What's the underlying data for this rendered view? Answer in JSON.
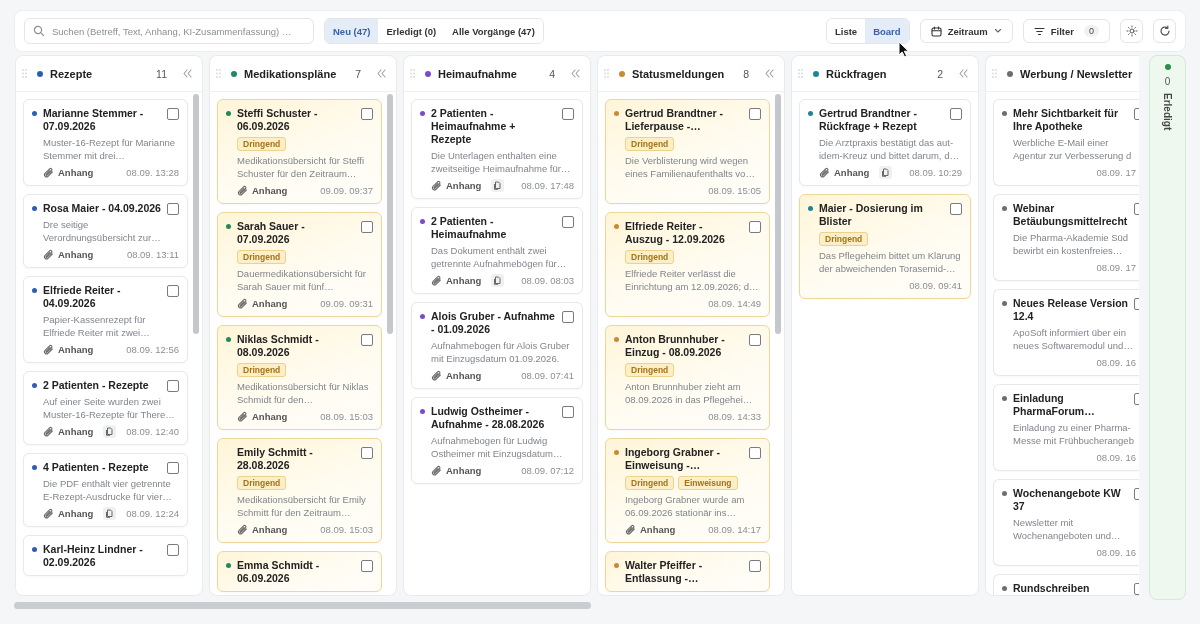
{
  "toolbar": {
    "search": {
      "placeholder": "Suchen (Betreff, Text, Anhang, KI-Zusammenfassung) …"
    },
    "status_tabs": [
      {
        "label": "Neu (47)",
        "selected": true
      },
      {
        "label": "Erledigt (0)",
        "selected": false
      },
      {
        "label": "Alle Vorgänge (47)",
        "selected": false
      }
    ],
    "view_tabs": [
      {
        "label": "Liste",
        "selected": false
      },
      {
        "label": "Board",
        "selected": true
      }
    ],
    "date_button": {
      "label": "Zeitraum"
    },
    "filter_button": {
      "label": "Filter",
      "count": "0"
    }
  },
  "columns": [
    {
      "name": "Rezepte",
      "color": "#2f5db5",
      "count": "11",
      "scrollable": true,
      "cards": [
        {
          "title": "Marianne Stemmer - 07.09.2026",
          "unread": true,
          "urgent": false,
          "checked": false,
          "description": "Muster-16-Rezept für Marianne Stemmer mit drei…",
          "attachment": "Anhang",
          "multi_page": false,
          "time": "08.09. 13:28"
        },
        {
          "title": "Rosa Maier - 04.09.2026",
          "unread": true,
          "urgent": false,
          "checked": false,
          "description": "Dre seitige Verordnungsübersicht zur…",
          "attachment": "Anhang",
          "multi_page": false,
          "time": "08.09. 13:11"
        },
        {
          "title": "Elfriede Reiter - 04.09.2026",
          "unread": true,
          "urgent": false,
          "checked": false,
          "description": "Papier-Kassenrezept für Elfriede Reiter mit zwei…",
          "attachment": "Anhang",
          "multi_page": false,
          "time": "08.09. 12:56"
        },
        {
          "title": "2 Patienten - Rezepte",
          "unread": true,
          "urgent": false,
          "checked": false,
          "description": "Auf einer Seite wurden zwei Muster-16-Rezepte für There…",
          "attachment": "Anhang",
          "multi_page": true,
          "time": "08.09. 12:40"
        },
        {
          "title": "4 Patienten - Rezepte",
          "unread": true,
          "urgent": false,
          "checked": false,
          "description": "Die PDF enthält vier getrennte E-Rezept-Ausdrucke für vier…",
          "attachment": "Anhang",
          "multi_page": true,
          "time": "08.09. 12:24"
        },
        {
          "title": "Karl-Heinz Lindner - 02.09.2026",
          "unread": true,
          "urgent": false,
          "checked": false
        }
      ]
    },
    {
      "name": "Medikationspläne",
      "color": "#1f8a5b",
      "count": "7",
      "scrollable": true,
      "cards": [
        {
          "title": "Steffi Schuster - 06.09.2026",
          "unread": true,
          "urgent": true,
          "checked": false,
          "tags": [
            "Dringend"
          ],
          "description": "Medikationsübersicht für Steffi Schuster für den Zeitraum…",
          "attachment": "Anhang",
          "multi_page": false,
          "time": "09.09. 09:37"
        },
        {
          "title": "Sarah Sauer - 07.09.2026",
          "unread": true,
          "urgent": true,
          "checked": false,
          "tags": [
            "Dringend"
          ],
          "description": "Dauermedikationsübersicht für Sarah Sauer mit fünf…",
          "attachment": "Anhang",
          "multi_page": false,
          "time": "09.09. 09:31"
        },
        {
          "title": "Niklas Schmidt - 08.09.2026",
          "unread": true,
          "urgent": true,
          "checked": false,
          "tags": [
            "Dringend"
          ],
          "description": "Medikationsübersicht für Niklas Schmidt für den…",
          "attachment": "Anhang",
          "multi_page": false,
          "time": "08.09. 15:03"
        },
        {
          "title": "Emily Schmitt - 28.08.2026",
          "unread": false,
          "urgent": true,
          "checked": false,
          "tags": [
            "Dringend"
          ],
          "description": "Medikationsübersicht für Emily Schmitt für den Zeitraum…",
          "attachment": "Anhang",
          "multi_page": false,
          "time": "08.09. 15:03"
        },
        {
          "title": "Emma Schmidt - 06.09.2026",
          "unread": true,
          "urgent": true,
          "checked": false
        }
      ]
    },
    {
      "name": "Heimaufnahme",
      "color": "#7a4cc8",
      "count": "4",
      "scrollable": false,
      "cards": [
        {
          "title": "2 Patienten - Heimaufnahme + Rezepte",
          "unread": true,
          "urgent": false,
          "checked": false,
          "description": "Die Unterlagen enthalten eine zweitseitige Heimaufnahme für…",
          "attachment": "Anhang",
          "multi_page": true,
          "time": "08.09. 17:48"
        },
        {
          "title": "2 Patienten - Heimaufnahme",
          "unread": true,
          "urgent": false,
          "checked": false,
          "description": "Das Dokument enthält zwei getrennte Aufnahmebögen für…",
          "attachment": "Anhang",
          "multi_page": true,
          "time": "08.09. 08:03"
        },
        {
          "title": "Alois Gruber - Aufnahme - 01.09.2026",
          "unread": true,
          "urgent": false,
          "checked": false,
          "description": "Aufnahmebogen für Alois Gruber mit Einzugsdatum 01.09.2026.",
          "attachment": "Anhang",
          "multi_page": false,
          "time": "08.09. 07:41"
        },
        {
          "title": "Ludwig Ostheimer - Aufnahme - 28.08.2026",
          "unread": true,
          "urgent": false,
          "checked": false,
          "description": "Aufnahmebogen für Ludwig Ostheimer mit Einzugsdatum…",
          "attachment": "Anhang",
          "multi_page": false,
          "time": "08.09. 07:12"
        }
      ]
    },
    {
      "name": "Statusmeldungen",
      "color": "#c98a34",
      "count": "8",
      "scrollable": true,
      "cards": [
        {
          "title": "Gertrud Brandtner - Lieferpause -…",
          "unread": true,
          "urgent": true,
          "checked": false,
          "tags": [
            "Dringend"
          ],
          "description": "Die Verblisterung wird wegen eines Familienaufenthalts vo…",
          "time": "08.09. 15:05"
        },
        {
          "title": "Elfriede Reiter - Auszug - 12.09.2026",
          "unread": true,
          "urgent": true,
          "checked": false,
          "tags": [
            "Dringend"
          ],
          "description": "Elfriede Reiter verlässt die Einrichtung am 12.09.2026; d…",
          "time": "08.09. 14:49"
        },
        {
          "title": "Anton Brunnhuber - Einzug - 08.09.2026",
          "unread": true,
          "urgent": true,
          "checked": false,
          "tags": [
            "Dringend"
          ],
          "description": "Anton Brunnhuber zieht am 08.09.2026 in das Pflegehei…",
          "time": "08.09. 14:33"
        },
        {
          "title": "Ingeborg Grabner - Einweisung -…",
          "unread": true,
          "urgent": true,
          "checked": false,
          "tags": [
            "Dringend",
            "Einweisung"
          ],
          "description": "Ingeborg Grabner wurde am 06.09.2026 stationär ins…",
          "attachment": "Anhang",
          "multi_page": false,
          "time": "08.09. 14:17"
        },
        {
          "title": "Walter Pfeiffer - Entlassung -…",
          "unread": true,
          "urgent": true,
          "checked": false
        }
      ]
    },
    {
      "name": "Rückfragen",
      "color": "#1e8497",
      "count": "2",
      "scrollable": false,
      "cards": [
        {
          "title": "Gertrud Brandtner - Rückfrage + Rezept",
          "unread": true,
          "urgent": false,
          "checked": false,
          "description": "Die Arztpraxis bestätigt das aut-idem-Kreuz und bittet darum, d…",
          "attachment": "Anhang",
          "multi_page": true,
          "time": "08.09. 10:29"
        },
        {
          "title": "Maier - Dosierung im Blister",
          "unread": true,
          "urgent": true,
          "checked": false,
          "tags": [
            "Dringend"
          ],
          "description": "Das Pflegeheim bittet um Klärung der abweichenden Torasemid-…",
          "time": "08.09. 09:41"
        }
      ]
    },
    {
      "name": "Werbung / Newsletter",
      "color": "#6b6e73",
      "scrollable": false,
      "cards": [
        {
          "title": "Mehr Sichtbarkeit für Ihre Apotheke",
          "unread": true,
          "urgent": false,
          "checked": false,
          "description": "Werbliche E-Mail einer Agentur zur Verbesserung d",
          "time": "08.09. 17"
        },
        {
          "title": "Webinar Betäubungsmittelrecht",
          "unread": true,
          "urgent": false,
          "checked": false,
          "description": "Die Pharma-Akademie Süd bewirbt ein kostenfreies…",
          "time": "08.09. 17"
        },
        {
          "title": "Neues Release Version 12.4",
          "unread": true,
          "urgent": false,
          "checked": false,
          "description": "ApoSoft informiert über ein neues Softwaremodul und…",
          "time": "08.09. 16"
        },
        {
          "title": "Einladung PharmaForum…",
          "unread": true,
          "urgent": false,
          "checked": false,
          "description": "Einladung zu einer Pharma-Messe mit Frühbucherangeb",
          "time": "08.09. 16"
        },
        {
          "title": "Wochenangebote KW 37",
          "unread": true,
          "urgent": false,
          "checked": false,
          "description": "Newsletter mit Wochenangeboten und…",
          "time": "08.09. 16"
        },
        {
          "title": "Rundschreiben",
          "unread": true,
          "urgent": false,
          "checked": false
        }
      ]
    }
  ],
  "done_column": {
    "name": "Erledigt",
    "count": "0",
    "color": "#2e8b4e"
  }
}
